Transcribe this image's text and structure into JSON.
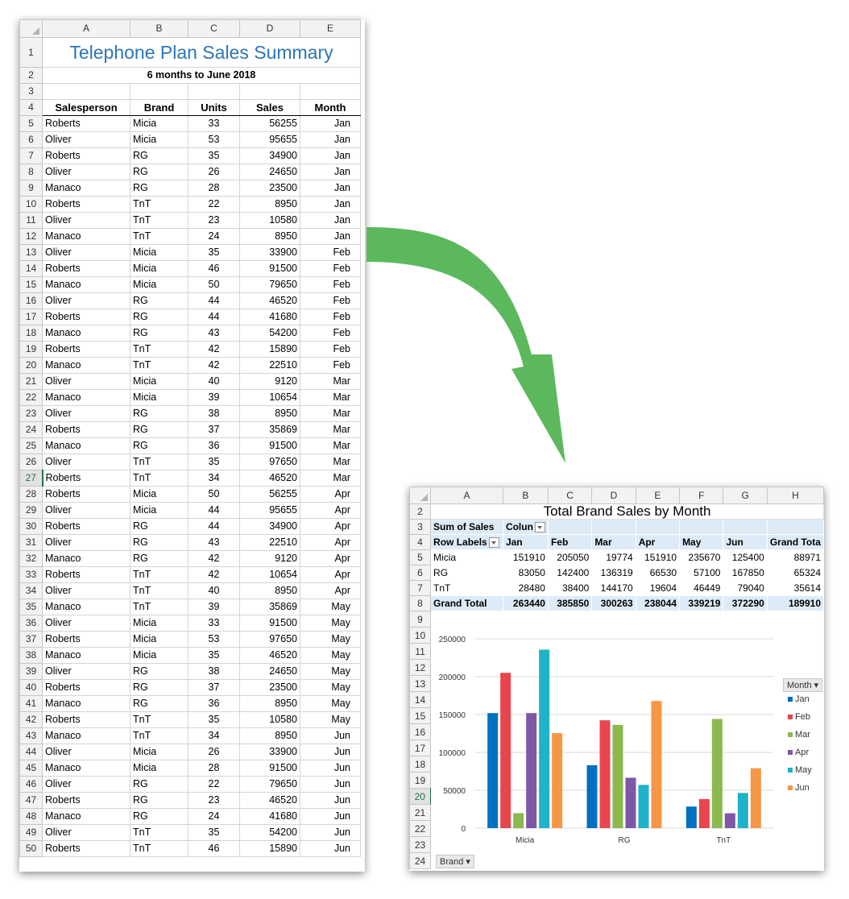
{
  "sheet1": {
    "columns": [
      "A",
      "B",
      "C",
      "D",
      "E"
    ],
    "title": "Telephone Plan Sales Summary",
    "subtitle": "6 months to June 2018",
    "headers": [
      "Salesperson",
      "Brand",
      "Units",
      "Sales",
      "Month"
    ],
    "rows": [
      [
        "Roberts",
        "Micia",
        "33",
        "56255",
        "Jan"
      ],
      [
        "Oliver",
        "Micia",
        "53",
        "95655",
        "Jan"
      ],
      [
        "Roberts",
        "RG",
        "35",
        "34900",
        "Jan"
      ],
      [
        "Oliver",
        "RG",
        "26",
        "24650",
        "Jan"
      ],
      [
        "Manaco",
        "RG",
        "28",
        "23500",
        "Jan"
      ],
      [
        "Roberts",
        "TnT",
        "22",
        "8950",
        "Jan"
      ],
      [
        "Oliver",
        "TnT",
        "23",
        "10580",
        "Jan"
      ],
      [
        "Manaco",
        "TnT",
        "24",
        "8950",
        "Jan"
      ],
      [
        "Oliver",
        "Micia",
        "35",
        "33900",
        "Feb"
      ],
      [
        "Roberts",
        "Micia",
        "46",
        "91500",
        "Feb"
      ],
      [
        "Manaco",
        "Micia",
        "50",
        "79650",
        "Feb"
      ],
      [
        "Oliver",
        "RG",
        "44",
        "46520",
        "Feb"
      ],
      [
        "Roberts",
        "RG",
        "44",
        "41680",
        "Feb"
      ],
      [
        "Manaco",
        "RG",
        "43",
        "54200",
        "Feb"
      ],
      [
        "Roberts",
        "TnT",
        "42",
        "15890",
        "Feb"
      ],
      [
        "Manaco",
        "TnT",
        "42",
        "22510",
        "Feb"
      ],
      [
        "Oliver",
        "Micia",
        "40",
        "9120",
        "Mar"
      ],
      [
        "Manaco",
        "Micia",
        "39",
        "10654",
        "Mar"
      ],
      [
        "Oliver",
        "RG",
        "38",
        "8950",
        "Mar"
      ],
      [
        "Roberts",
        "RG",
        "37",
        "35869",
        "Mar"
      ],
      [
        "Manaco",
        "RG",
        "36",
        "91500",
        "Mar"
      ],
      [
        "Oliver",
        "TnT",
        "35",
        "97650",
        "Mar"
      ],
      [
        "Roberts",
        "TnT",
        "34",
        "46520",
        "Mar"
      ],
      [
        "Roberts",
        "Micia",
        "50",
        "56255",
        "Apr"
      ],
      [
        "Oliver",
        "Micia",
        "44",
        "95655",
        "Apr"
      ],
      [
        "Roberts",
        "RG",
        "44",
        "34900",
        "Apr"
      ],
      [
        "Oliver",
        "RG",
        "43",
        "22510",
        "Apr"
      ],
      [
        "Manaco",
        "RG",
        "42",
        "9120",
        "Apr"
      ],
      [
        "Roberts",
        "TnT",
        "42",
        "10654",
        "Apr"
      ],
      [
        "Oliver",
        "TnT",
        "40",
        "8950",
        "Apr"
      ],
      [
        "Manaco",
        "TnT",
        "39",
        "35869",
        "May"
      ],
      [
        "Oliver",
        "Micia",
        "33",
        "91500",
        "May"
      ],
      [
        "Roberts",
        "Micia",
        "53",
        "97650",
        "May"
      ],
      [
        "Manaco",
        "Micia",
        "35",
        "46520",
        "May"
      ],
      [
        "Oliver",
        "RG",
        "38",
        "24650",
        "May"
      ],
      [
        "Roberts",
        "RG",
        "37",
        "23500",
        "May"
      ],
      [
        "Manaco",
        "RG",
        "36",
        "8950",
        "May"
      ],
      [
        "Roberts",
        "TnT",
        "35",
        "10580",
        "May"
      ],
      [
        "Manaco",
        "TnT",
        "34",
        "8950",
        "Jun"
      ],
      [
        "Oliver",
        "Micia",
        "26",
        "33900",
        "Jun"
      ],
      [
        "Manaco",
        "Micia",
        "28",
        "91500",
        "Jun"
      ],
      [
        "Oliver",
        "RG",
        "22",
        "79650",
        "Jun"
      ],
      [
        "Roberts",
        "RG",
        "23",
        "46520",
        "Jun"
      ],
      [
        "Manaco",
        "RG",
        "24",
        "41680",
        "Jun"
      ],
      [
        "Oliver",
        "TnT",
        "35",
        "54200",
        "Jun"
      ],
      [
        "Roberts",
        "TnT",
        "46",
        "15890",
        "Jun"
      ]
    ],
    "selected_row": 27,
    "title_color": "#2e75b6"
  },
  "sheet2": {
    "columns": [
      "A",
      "B",
      "C",
      "D",
      "E",
      "F",
      "G",
      "H"
    ],
    "title": "Total Brand Sales by Month",
    "sum_label": "Sum of Sales",
    "col_labels_btn": "Colun",
    "row_labels_btn": "Row Labels",
    "months": [
      "Jan",
      "Feb",
      "Mar",
      "Apr",
      "May",
      "Jun"
    ],
    "grand_total_col": "Grand Tota",
    "pivot_rows": [
      {
        "label": "Micia",
        "values": [
          "151910",
          "205050",
          "19774",
          "151910",
          "235670",
          "125400"
        ],
        "total": "88971"
      },
      {
        "label": "RG",
        "values": [
          "83050",
          "142400",
          "136319",
          "66530",
          "57100",
          "167850"
        ],
        "total": "65324"
      },
      {
        "label": "TnT",
        "values": [
          "28480",
          "38400",
          "144170",
          "19604",
          "46449",
          "79040"
        ],
        "total": "35614"
      }
    ],
    "grand_total": {
      "label": "Grand Total",
      "values": [
        "263440",
        "385850",
        "300263",
        "238044",
        "339219",
        "372290"
      ],
      "total": "189910"
    },
    "brand_button": "Brand",
    "month_button": "Month",
    "selected_row": 20
  },
  "chart_data": {
    "type": "bar",
    "categories": [
      "Micia",
      "RG",
      "TnT"
    ],
    "series": [
      {
        "name": "Jan",
        "values": [
          151910,
          83050,
          28480
        ],
        "color": "#0070c0"
      },
      {
        "name": "Feb",
        "values": [
          205050,
          142400,
          38400
        ],
        "color": "#e8464f"
      },
      {
        "name": "Mar",
        "values": [
          19774,
          136319,
          144170
        ],
        "color": "#8bb84f"
      },
      {
        "name": "Apr",
        "values": [
          151910,
          66530,
          19604
        ],
        "color": "#7e57a7"
      },
      {
        "name": "May",
        "values": [
          235670,
          57100,
          46449
        ],
        "color": "#1fb3c8"
      },
      {
        "name": "Jun",
        "values": [
          125400,
          167850,
          79040
        ],
        "color": "#f79646"
      }
    ],
    "yticks": [
      0,
      50000,
      100000,
      150000,
      200000,
      250000
    ],
    "ylim": [
      0,
      250000
    ],
    "legend_title": "Month",
    "legend_position": "right",
    "grid": true
  },
  "arrow_color": "#5cb85c"
}
